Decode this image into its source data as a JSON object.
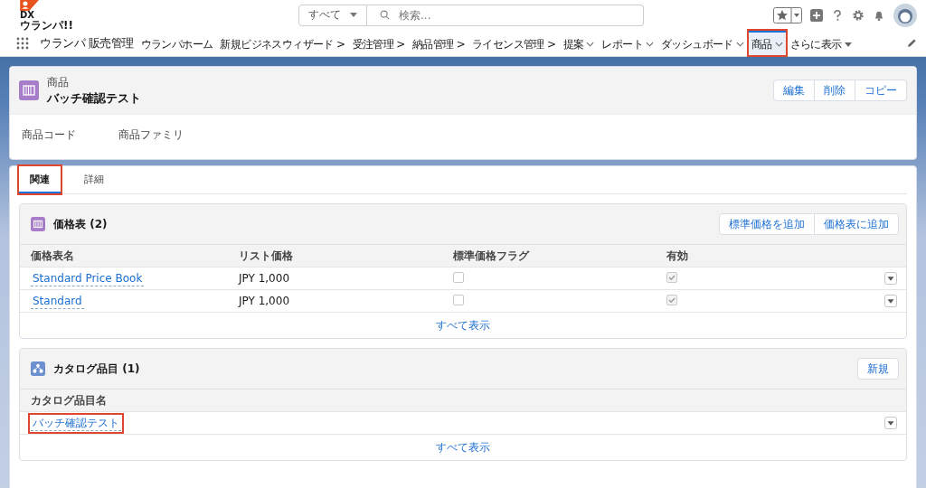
{
  "header": {
    "logo": {
      "line1": "DX",
      "line2": "ウランパ!!"
    },
    "search": {
      "scope": "すべて",
      "placeholder": "検索..."
    }
  },
  "nav": {
    "app_name": "ウランパ 販売管理",
    "items": [
      {
        "label": "ウランパホーム",
        "kind": "plain",
        "selected": false,
        "highlighted": false
      },
      {
        "label": "新規ビジネスウィザード >",
        "kind": "plain",
        "selected": false,
        "highlighted": false
      },
      {
        "label": "受注管理 >",
        "kind": "plain",
        "selected": false,
        "highlighted": false
      },
      {
        "label": "納品管理 >",
        "kind": "plain",
        "selected": false,
        "highlighted": false
      },
      {
        "label": "ライセンス管理 >",
        "kind": "plain",
        "selected": false,
        "highlighted": false
      },
      {
        "label": "提案",
        "kind": "dropdown",
        "selected": false,
        "highlighted": false
      },
      {
        "label": "レポート",
        "kind": "dropdown",
        "selected": false,
        "highlighted": false
      },
      {
        "label": "ダッシュボード",
        "kind": "dropdown",
        "selected": false,
        "highlighted": false
      },
      {
        "label": "商品",
        "kind": "dropdown",
        "selected": true,
        "highlighted": true
      },
      {
        "label": "さらに表示",
        "kind": "more",
        "selected": false,
        "highlighted": false
      }
    ]
  },
  "record": {
    "object": "商品",
    "title": "バッチ確認テスト",
    "actions": [
      "編集",
      "削除",
      "コピー"
    ],
    "fields": [
      "商品コード",
      "商品ファミリ"
    ]
  },
  "tabs": [
    {
      "label": "関連",
      "selected": true,
      "highlighted": true
    },
    {
      "label": "詳細",
      "selected": false,
      "highlighted": false
    }
  ],
  "price_books": {
    "title": "価格表 (2)",
    "actions": [
      "標準価格を追加",
      "価格表に追加"
    ],
    "columns": [
      "価格表名",
      "リスト価格",
      "標準価格フラグ",
      "有効"
    ],
    "rows": [
      {
        "name": "Standard Price Book",
        "price": "JPY 1,000",
        "standard": false,
        "active": true
      },
      {
        "name": "Standard",
        "price": "JPY 1,000",
        "standard": false,
        "active": true
      }
    ],
    "view_all": "すべて表示"
  },
  "catalog_items": {
    "title": "カタログ品目 (1)",
    "actions": [
      "新規"
    ],
    "columns": [
      "カタログ品目名"
    ],
    "rows": [
      {
        "name": "バッチ確認テスト",
        "highlighted": true
      }
    ],
    "view_all": "すべて表示"
  }
}
